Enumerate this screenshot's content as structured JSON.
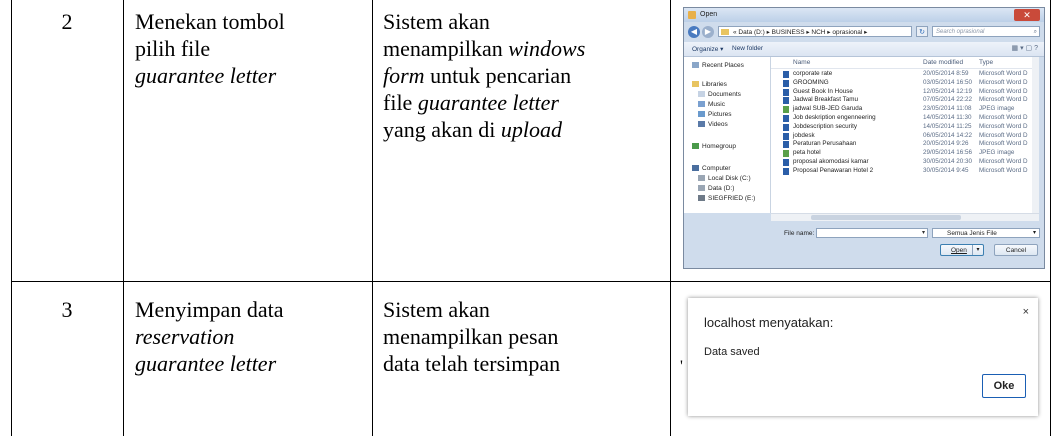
{
  "rows": [
    {
      "number": "2",
      "action_line1": "Menekan tombol",
      "action_line2": "pilih file",
      "action_line3_italic": "guarantee letter",
      "result_line1": "Sistem akan",
      "result_line2_prefix": "menampilkan ",
      "result_line2_italic": "windows",
      "result_line3_italic": "form",
      "result_line3_suffix": " untuk pencarian",
      "result_line4_prefix": "file ",
      "result_line4_italic": "guarantee letter",
      "result_line5_prefix": "yang akan di ",
      "result_line5_italic": "upload"
    },
    {
      "number": "3",
      "action_line1": "Menyimpan data",
      "action_line2_italic": "reservation",
      "action_line3_italic": "guarantee letter",
      "result_line1": "Sistem akan",
      "result_line2": "menampilkan pesan",
      "result_line3": "data telah tersimpan"
    }
  ],
  "open_dialog": {
    "title": "Open",
    "close_symbol": "✕",
    "path": "« Data (D:) ▸ BUSINESS ▸ NCH ▸ oprasional ▸",
    "search_placeholder": "Search oprasional",
    "organize": "Organize ▾",
    "new_folder": "New folder",
    "nav": [
      {
        "label": "Recent Places",
        "icon": "recent-places-icon"
      },
      {
        "label": "Libraries",
        "icon": "libraries-icon"
      },
      {
        "label": "Documents",
        "icon": "documents-icon"
      },
      {
        "label": "Music",
        "icon": "music-icon"
      },
      {
        "label": "Pictures",
        "icon": "pictures-icon"
      },
      {
        "label": "Videos",
        "icon": "videos-icon"
      },
      {
        "label": "Homegroup",
        "icon": "homegroup-icon"
      },
      {
        "label": "Computer",
        "icon": "computer-icon"
      },
      {
        "label": "Local Disk (C:)",
        "icon": "drive-icon"
      },
      {
        "label": "Data (D:)",
        "icon": "drive-icon"
      },
      {
        "label": "SIEGFRIED (E:)",
        "icon": "drive-icon"
      }
    ],
    "columns": {
      "name": "Name",
      "date": "Date modified",
      "type": "Type"
    },
    "files": [
      {
        "name": "corporate rate",
        "date": "20/05/2014 8:59",
        "type": "Microsoft Word D"
      },
      {
        "name": "GROOMING",
        "date": "03/05/2014 16:50",
        "type": "Microsoft Word D"
      },
      {
        "name": "Guest Book In House",
        "date": "12/05/2014 12:19",
        "type": "Microsoft Word D"
      },
      {
        "name": "Jadwal Breakfast Tamu",
        "date": "07/05/2014 22:22",
        "type": "Microsoft Word D"
      },
      {
        "name": "jadwal SUB-JED Garuda",
        "date": "23/05/2014 11:08",
        "type": "JPEG image"
      },
      {
        "name": "Job deskription engenneering",
        "date": "14/05/2014 11:30",
        "type": "Microsoft Word D"
      },
      {
        "name": "Jobdescription security",
        "date": "14/05/2014 11:25",
        "type": "Microsoft Word D"
      },
      {
        "name": "jobdesk",
        "date": "06/05/2014 14:22",
        "type": "Microsoft Word D"
      },
      {
        "name": "Peraturan Perusahaan",
        "date": "20/05/2014 9:26",
        "type": "Microsoft Word D"
      },
      {
        "name": "peta hotel",
        "date": "29/05/2014 16:56",
        "type": "JPEG image"
      },
      {
        "name": "proposal akomodasi kamar",
        "date": "30/05/2014 20:30",
        "type": "Microsoft Word D"
      },
      {
        "name": "Proposal Penawaran Hotel 2",
        "date": "30/05/2014 9:45",
        "type": "Microsoft Word D"
      }
    ],
    "file_name_label": "File name:",
    "file_name_value": "",
    "file_type": "Semua Jenis File",
    "open_button": "Open",
    "cancel_button": "Cancel"
  },
  "alert_dialog": {
    "title": "localhost menyatakan:",
    "message": "Data saved",
    "ok_button": "Oke",
    "close_symbol": "×"
  },
  "stray_mark": "'"
}
